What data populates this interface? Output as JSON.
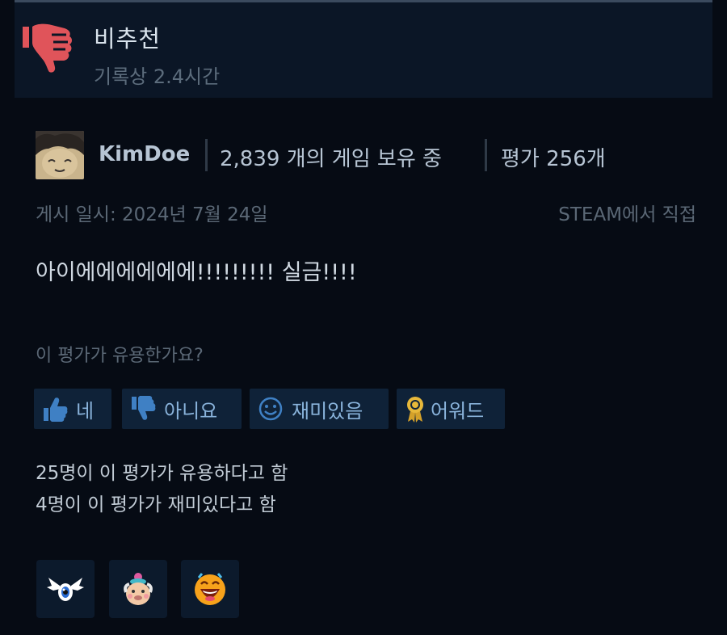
{
  "review": {
    "verdict": "비추천",
    "hours": "기록상 2.4시간",
    "text": "아이에에에에에에!!!!!!!!! 실금!!!!"
  },
  "author": {
    "name": "KimDoe",
    "games": "2,839 개의 게임 보유 중",
    "reviews": "평가 256개"
  },
  "meta": {
    "posted": "게시 일시: 2024년 7월 24일",
    "source": "STEAM에서 직접"
  },
  "helpful": {
    "question": "이 평가가 유용한가요?",
    "buttons": [
      {
        "label": "네",
        "icon": "thumbs-up-icon"
      },
      {
        "label": "아니요",
        "icon": "thumbs-down-icon"
      },
      {
        "label": "재미있음",
        "icon": "smiley-icon"
      },
      {
        "label": "어워드",
        "icon": "award-medal-icon"
      }
    ],
    "stat_helpful": "25명이 이 평가가 유용하다고 함",
    "stat_funny": "4명이 이 평가가 재미있다고 함"
  },
  "awards": [
    {
      "icon": "winged-eye-award-icon"
    },
    {
      "icon": "old-man-face-award-icon"
    },
    {
      "icon": "laughing-face-award-icon"
    }
  ],
  "colors": {
    "background": "#060b14",
    "header_bg": "#0b1626",
    "thumbs_down_red": "#e0545a",
    "button_bg": "#0f2238",
    "button_text": "#8ab4dc"
  }
}
